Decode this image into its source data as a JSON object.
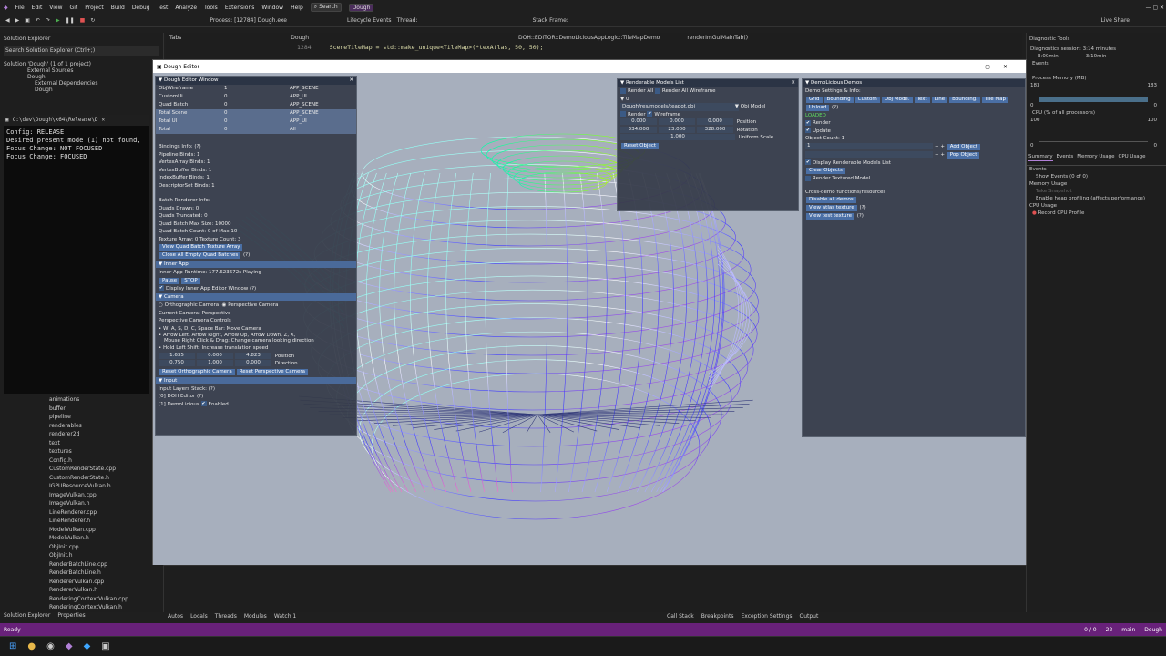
{
  "vs": {
    "menu": [
      "File",
      "Edit",
      "View",
      "Git",
      "Project",
      "Build",
      "Debug",
      "Test",
      "Analyze",
      "Tools",
      "Extensions",
      "Window",
      "Help"
    ],
    "search": "Search",
    "solution_name": "Dough",
    "process": "Process: [12784] Dough.exe",
    "lifecycle": "Lifecycle Events",
    "thread": "Thread:",
    "stackframe": "Stack Frame:",
    "live_share": "Live Share",
    "status_ready": "Ready",
    "status_right": [
      "0 / 0",
      "22",
      "main",
      "Dough"
    ]
  },
  "solution_explorer": {
    "title": "Solution Explorer",
    "search_placeholder": "Search Solution Explorer (Ctrl+;)",
    "root": "Solution 'Dough' (1 of 1 project)",
    "items": [
      "External Sources",
      "Dough",
      "External Dependencies",
      "Dough"
    ],
    "files": [
      "animations",
      "buffer",
      "pipeline",
      "renderables",
      "renderer2d",
      "text",
      "textures",
      "Config.h",
      "CustomRenderState.cpp",
      "CustomRenderState.h",
      "IGPUResourceVulkan.h",
      "ImageVulkan.cpp",
      "ImageVulkan.h",
      "LineRenderer.cpp",
      "LineRenderer.h",
      "ModelVulkan.cpp",
      "ModelVulkan.h",
      "ObjInit.cpp",
      "ObjInit.h",
      "RenderBatchLine.cpp",
      "RenderBatchLine.h",
      "RendererVulkan.cpp",
      "RendererVulkan.h",
      "RenderingContextVulkan.cpp",
      "RenderingContextVulkan.h"
    ],
    "bottom_tabs": [
      "Solution Explorer",
      "Properties"
    ]
  },
  "terminal": {
    "tab": "C:\\dev\\Dough\\x64\\Release\\D",
    "lines": [
      "Config: RELEASE",
      "Desired present mode (1) not found,",
      "Focus Change: NOT FOCUSED",
      "Focus Change: FOCUSED"
    ]
  },
  "editor": {
    "tabs": [
      "Tabs",
      "Dough",
      "DOH::EDITOR::DemoLiciousAppLogic::TileMapDemo",
      "renderImGuiMainTab()"
    ],
    "line_no": "1284",
    "code": "SceneTileMap = std::make_unique<TileMap>(*texAtlas, 50, 50);"
  },
  "bottom": {
    "left_tabs": [
      "Autos",
      "Locals",
      "Threads",
      "Modules",
      "Watch 1"
    ],
    "right_tabs": [
      "Call Stack",
      "Breakpoints",
      "Exception Settings",
      "Output"
    ]
  },
  "diag": {
    "title": "Diagnostic Tools",
    "session": "Diagnostics session: 3:14 minutes",
    "t1": "3:00min",
    "t2": "3:10min",
    "events": "Events",
    "process_memory": "Process Memory (MB)",
    "mem_hi": "183",
    "mem_lo": "0",
    "cpu": "CPU (% of all processors)",
    "cpu_hi": "100",
    "cpu_lo": "0",
    "tabs": [
      "Summary",
      "Events",
      "Memory Usage",
      "CPU Usage"
    ],
    "events_hdr": "Events",
    "show_events": "Show Events (0 of 0)",
    "memory_usage": "Memory Usage",
    "take_snapshot": "Take Snapshot",
    "heap": "Enable heap profiling (affects performance)",
    "cpu_usage": "CPU Usage",
    "record": "Record CPU Profile"
  },
  "dough": {
    "window_title": "Dough Editor",
    "editor_win": {
      "title": "Dough Editor Window",
      "rows": [
        [
          "ObjWireframe",
          "1",
          "APP_SCENE"
        ],
        [
          "CustomUi",
          "0",
          "APP_UI"
        ],
        [
          "Quad Batch",
          "0",
          "APP_SCENE"
        ],
        [
          "Total Scene",
          "0",
          "APP_SCENE"
        ],
        [
          "Total UI",
          "0",
          "APP_UI"
        ],
        [
          "Total",
          "0",
          "All"
        ]
      ],
      "bindings": [
        "Bindings Info: (?)",
        "Pipeline Binds: 1",
        "VertexArray Binds: 1",
        "VertexBuffer Binds: 1",
        "IndexBuffer Binds: 1",
        "DescriptorSet Binds: 1"
      ],
      "batch": [
        "Batch Renderer Info:",
        "Quads Drawn: 0",
        "Quads Truncated: 0",
        "Quad Batch Max Size: 10000",
        "Quad Batch Count: 0 of Max 10",
        "Texture Array: 0 Texture Count: 3"
      ],
      "btn_view_quad": "View Quad Batch Texture Array",
      "btn_close_empty": "Close All Empty Quad Batches",
      "q": "(?)",
      "inner_app_hdr": "Inner App",
      "runtime": "Inner App Runtime: 177.623672s Playing",
      "btn_pause": "Pause",
      "btn_stop": "STOP",
      "display_inner": "Display Inner App Editor Window (?)",
      "camera_hdr": "Camera",
      "ortho": "Orthographic Camera",
      "persp": "Perspective Camera",
      "current_cam": "Current Camera:  Perspective",
      "persp_controls": "Perspective Camera Controls",
      "ctrl1": "W, A, S, D, C, Space Bar: Move Camera",
      "ctrl2": "Arrow Left, Arrow Right, Arrow Up, Arrow Down, Z, X,",
      "ctrl3": "Mouse Right Click & Drag: Change camera looking direction",
      "ctrl4": "Hold Left Shift: Increase translation speed",
      "pos": [
        "1.635",
        "0.000",
        "4.823"
      ],
      "pos_lbl": "Position",
      "dir": [
        "0.750",
        "1.000",
        "0.000"
      ],
      "dir_lbl": "Direction",
      "btn_reset_ortho": "Reset Orthographic Camera",
      "btn_reset_persp": "Reset Perspective Camera",
      "input_hdr": "Input",
      "input_stack": "Input Layers Stack: (?)",
      "layer0": "[0]  DOH Editor (?)",
      "layer1": "[1]  DemoLicious",
      "enabled": "Enabled"
    },
    "models_win": {
      "title": "Renderable Models List",
      "render_all": "Render All",
      "render_all_wire": "Render All Wireframe",
      "idx": "0",
      "model_path": "Dough/res/models/teapot.obj",
      "obj_model": "Obj Model",
      "render": "Render",
      "wireframe": "Wireframe",
      "position": [
        "0.000",
        "0.000",
        "0.000"
      ],
      "position_lbl": "Position",
      "rotation": [
        "334.000",
        "23.000",
        "328.000"
      ],
      "rotation_lbl": "Rotation",
      "scale": "1.000",
      "scale_lbl": "Uniform Scale",
      "btn_reset": "Reset Object"
    },
    "demos_win": {
      "title": "DemoLicious Demos",
      "settings": "Demo Settings & Info:",
      "tabs": [
        "Grid",
        "Bounding",
        "Custom",
        "Obj Mode.",
        "Text",
        "Line",
        "Bounding.",
        "Tile Map"
      ],
      "btn_unload": "Unload",
      "q": "(?)",
      "loaded": "LOADED",
      "render": "Render",
      "update": "Update",
      "obj_count": "Object Count: 1",
      "count_val": "1",
      "btn_add": "Add Object",
      "btn_pop": "Pop Object",
      "display_list": "Display Renderable Models List",
      "btn_clear": "Clear Objects",
      "render_textured": "Render Textured Model",
      "cross": "Cross-demo functions/resources",
      "btn_disable": "Disable all demos",
      "btn_atlas": "View atlas texture",
      "btn_test": "View test texture"
    }
  }
}
